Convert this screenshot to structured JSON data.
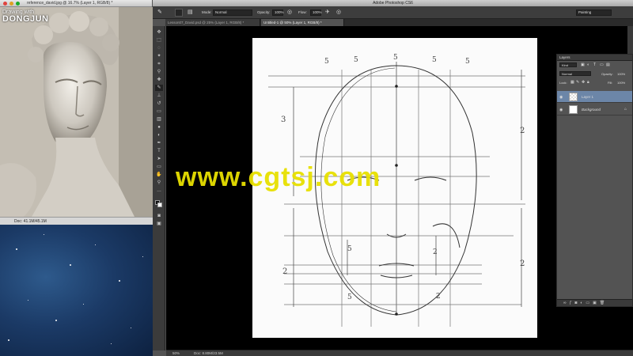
{
  "reference_window": {
    "title": "reference_david.jpg @ 16.7% (Layer 1, RGB/8) *",
    "status": "Doc: 41.1M/45.1M"
  },
  "logo": {
    "line1": "Drawing with",
    "line2": "DONGJUN"
  },
  "photoshop": {
    "title": "Adobe Photoshop CS6",
    "options": {
      "mode_label": "Mode:",
      "mode_value": "Normal",
      "opacity_label": "Opacity:",
      "opacity_value": "100%",
      "flow_label": "Flow:",
      "flow_value": "100%",
      "workspace": "Painting"
    },
    "tabs": [
      {
        "label": "Lesson07_David.psd @ 25% (Layer 1, RGB/8) *"
      },
      {
        "label": "Untitled-1 @ 50% (Layer 1, RGB/8) *"
      }
    ],
    "status": {
      "zoom": "50%",
      "doc": "Doc: 8.80M/23.5M"
    }
  },
  "layers_panel": {
    "title": "Layers",
    "filter": "Kind",
    "blend_mode": "Normal",
    "opacity_label": "Opacity:",
    "opacity_value": "100%",
    "lock_label": "Lock:",
    "fill_label": "Fill:",
    "fill_value": "100%",
    "layers": [
      {
        "name": "Layer 1"
      },
      {
        "name": "Background"
      }
    ]
  },
  "sketch_labels": {
    "fifths": [
      "5",
      "5",
      "5",
      "5",
      "5"
    ],
    "left_third": "3",
    "right_half_top": "2",
    "right_half_bottom": "2",
    "mid_fifth_left": "5",
    "mid_half_right": "2",
    "bottom_fifth": "5",
    "bottom_half": "2",
    "bottom_left_half": "2"
  },
  "watermark": {
    "text": "www.cgtsj.com"
  },
  "colors": {
    "watermark": "#e8e000",
    "selected_layer": "#6c86a8",
    "panel_bg": "#535353",
    "toolbar_bg": "#3b3b3b"
  }
}
